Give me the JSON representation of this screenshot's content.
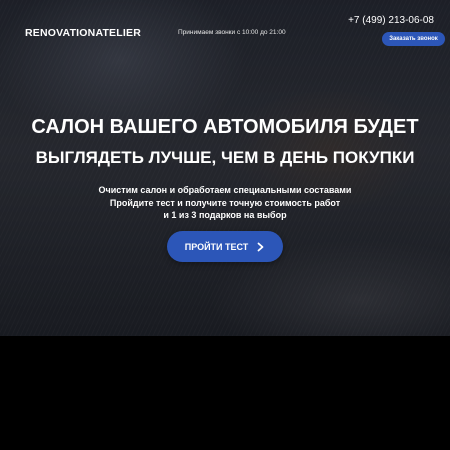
{
  "header": {
    "logo": "RENOVATIONATELIER",
    "hours": "Принимаем звонки с 10:00 до 21:00",
    "phone": "+7 (499) 213-06-08",
    "callback_label": "Заказать звонок"
  },
  "hero": {
    "headline_line1": "САЛОН ВАШЕГО АВТОМОБИЛЯ БУДЕТ",
    "headline_line2": "ВЫГЛЯДЕТЬ ЛУЧШЕ, ЧЕМ В ДЕНЬ ПОКУПКИ",
    "sub_lines": [
      "Очистим салон и обработаем специальными составами",
      "Пройдите тест и получите точную стоимость работ",
      "и 1 из 3 подарков на выбор"
    ],
    "cta_label": "ПРОЙТИ ТЕСТ",
    "cta_icon": "chevron-right-icon"
  },
  "colors": {
    "accent": "#2c56b8",
    "text": "#ffffff",
    "background": "#000000"
  }
}
